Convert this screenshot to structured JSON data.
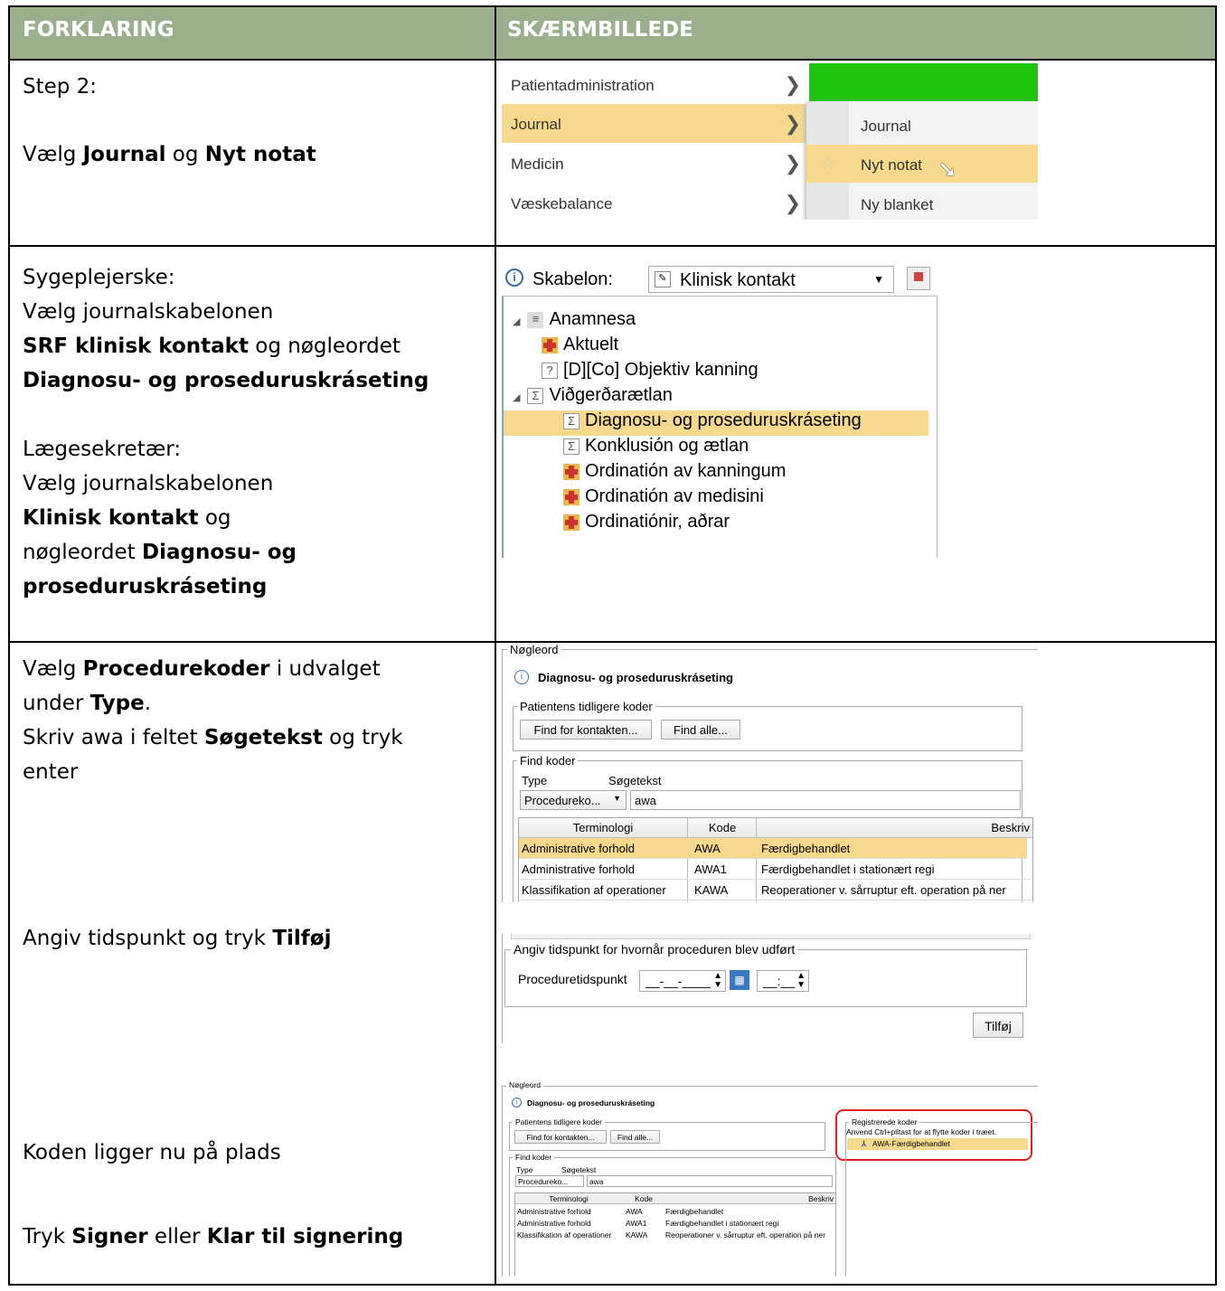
{
  "header": {
    "col1": "FORKLARING",
    "col2": "SKÆRMBILLEDE"
  },
  "row1": {
    "step": "Step 2:",
    "t1": "Vælg ",
    "b1": "Journal",
    "t2": " og ",
    "b2": "Nyt notat"
  },
  "row2": {
    "l1": "Sygeplejerske:",
    "l2": "Vælg journalskabelonen",
    "l3b": "SRF klinisk kontakt",
    "l3t": " og nøgleordet",
    "l4b": "Diagnosu- og proseduruskráseting",
    "l5": "Lægesekretær:",
    "l6": "Vælg journalskabelonen",
    "l7b": "Klinisk kontakt",
    "l7t": " og",
    "l8t": "nøgleordet ",
    "l8b": "Diagnosu- og",
    "l9b": "proseduruskráseting"
  },
  "row3": {
    "t1": "Vælg ",
    "b1": "Procedurekoder",
    "t2": " i udvalget",
    "t3": "under ",
    "b3": "Type",
    "t3e": ".",
    "t4": "Skriv awa i feltet ",
    "b4": "Søgetekst",
    "t4e": " og tryk",
    "t5": "enter",
    "t6": "Angiv tidspunkt og tryk ",
    "b6": "Tilføj",
    "t7": "Koden ligger nu på plads",
    "t8": "Tryk ",
    "b8": "Signer",
    "t8m": " eller ",
    "b8b": "Klar til signering"
  },
  "menu": {
    "left": [
      "Patientadministration",
      "Journal",
      "Medicin",
      "Væskebalance"
    ],
    "right": [
      "Journal",
      "Nyt notat",
      "Ny blanket"
    ]
  },
  "template": {
    "label": "Skabelon:",
    "value": "Klinisk kontakt",
    "tree": [
      "Anamnesa",
      "Aktuelt",
      "[D][Co] Objektiv kanning",
      "Viðgerðarætlan",
      "Diagnosu- og proseduruskráseting",
      "Konklusión og ætlan",
      "Ordinatión av kanningum",
      "Ordinatión av medisini",
      "Ordinatiónir, aðrar"
    ]
  },
  "kw": {
    "legend": "Nøgleord",
    "title": "Diagnosu- og proseduruskráseting",
    "prev_legend": "Patientens tidligere koder",
    "btn_contact": "Find for kontakten...",
    "btn_all": "Find alle...",
    "find_legend": "Find koder",
    "type_label": "Type",
    "search_label": "Søgetekst",
    "type_value": "Procedureko...",
    "search_value": "awa",
    "cols": [
      "Terminologi",
      "Kode",
      "Beskriv"
    ],
    "rows": [
      [
        "Administrative forhold",
        "AWA",
        "Færdigbehandlet"
      ],
      [
        "Administrative forhold",
        "AWA1",
        "Færdigbehandlet i stationært regi"
      ],
      [
        "Klassifikation af operationer",
        "KAWA",
        "Reoperationer v. sårruptur eft. operation på ner"
      ]
    ]
  },
  "time": {
    "legend": "Angiv tidspunkt for hvornår proceduren blev udført",
    "label": "Proceduretidspunkt",
    "date": "__-__-____",
    "clock": "__:__",
    "add": "Tilføj"
  },
  "reg": {
    "legend": "Registrerede koder",
    "hint": "Anvend Ctrl+piltast for at flytte koder i træet.",
    "item": "AWA-Færdigbehandlet"
  }
}
